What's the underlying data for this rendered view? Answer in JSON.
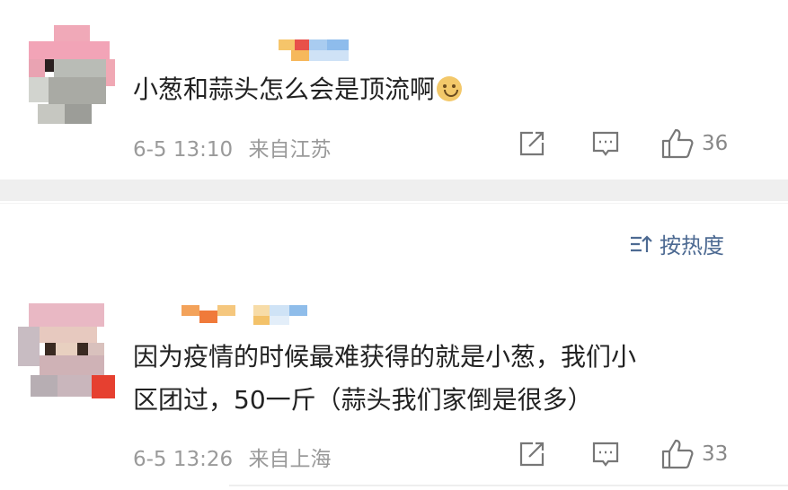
{
  "comments": [
    {
      "text": "小葱和蒜头怎么会是顶流啊",
      "emoji": "smiling-face-emoji",
      "date": "6-5 13:10",
      "location": "来自江苏",
      "likes": "36"
    },
    {
      "text_line1": "因为疫情的时候最难获得的就是小葱，我们小",
      "text_line2": "区团过，50一斤（蒜头我们家倒是很多）",
      "date": "6-5 13:26",
      "location": "来自上海",
      "likes": "33"
    }
  ],
  "sort": {
    "label": "按热度",
    "icon": "sort-icon"
  },
  "icons": [
    "share-icon",
    "comment-icon",
    "like-icon"
  ],
  "colors": {
    "link": "#4d6a92",
    "meta": "#9a9a9a",
    "text": "#222222"
  }
}
